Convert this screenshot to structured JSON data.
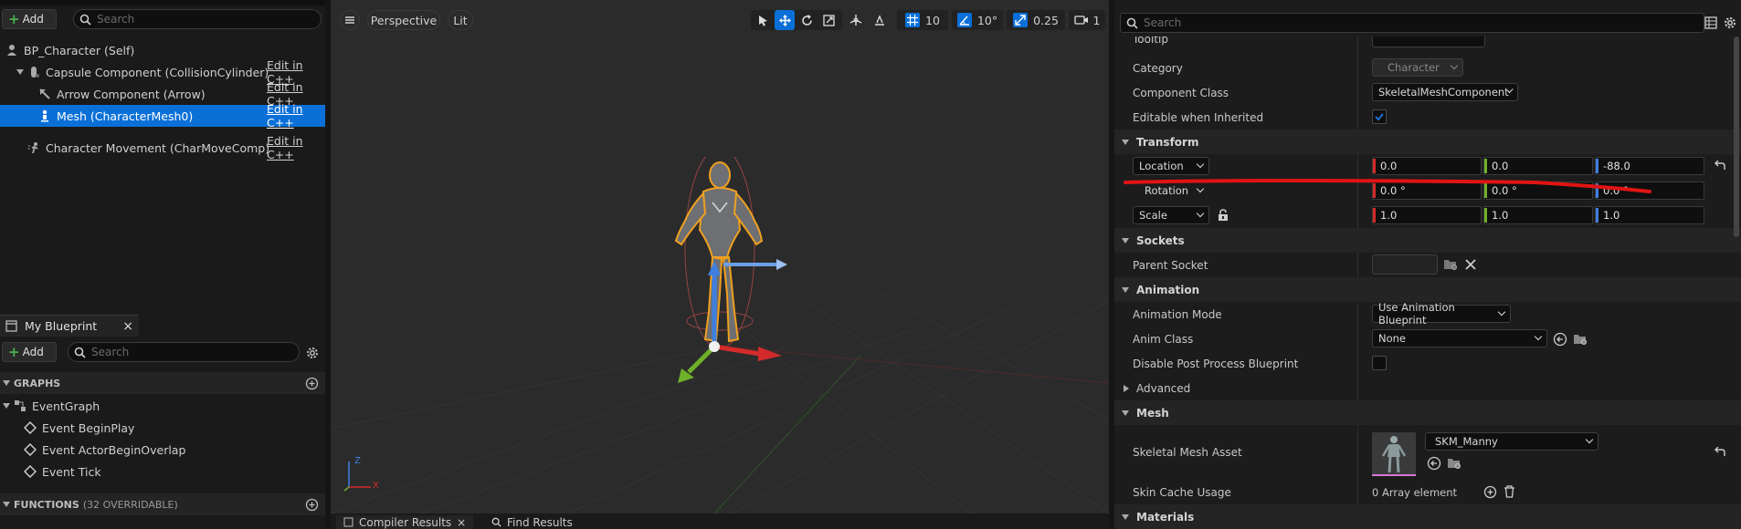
{
  "components": {
    "add_label": "Add",
    "search_placeholder": "Search",
    "items": [
      {
        "label": "BP_Character (Self)",
        "edit": ""
      },
      {
        "label": "Capsule Component (CollisionCylinder)",
        "edit": "Edit in C++"
      },
      {
        "label": "Arrow Component (Arrow)",
        "edit": "Edit in C++"
      },
      {
        "label": "Mesh (CharacterMesh0)",
        "edit": "Edit in C++"
      },
      {
        "label": "Character Movement (CharMoveComp)",
        "edit": "Edit in C++"
      }
    ]
  },
  "my_blueprint": {
    "tab_label": "My Blueprint",
    "close": "×",
    "add_label": "Add",
    "search_placeholder": "Search",
    "graphs_header": "GRAPHS",
    "event_graph": "EventGraph",
    "events": [
      "Event BeginPlay",
      "Event ActorBeginOverlap",
      "Event Tick"
    ],
    "functions_header": "FUNCTIONS",
    "functions_count": "(32 OVERRIDABLE)"
  },
  "viewport": {
    "perspective_label": "Perspective",
    "lit_label": "Lit",
    "grid_snap": "10",
    "rot_snap": "10°",
    "scale_snap": "0.25",
    "camera_speed": "1",
    "axis_x": "X",
    "axis_z": "Z"
  },
  "bottom_tabs": {
    "compiler": "Compiler Results",
    "find": "Find Results"
  },
  "details": {
    "search_placeholder": "Search",
    "tooltip_label": "Tooltip",
    "category_label": "Category",
    "category_value": "Character",
    "component_class_label": "Component Class",
    "component_class_value": "SkeletalMeshComponent",
    "editable_label": "Editable when Inherited",
    "transform_header": "Transform",
    "location_label": "Location",
    "location_values": [
      "0.0",
      "0.0",
      "-88.0"
    ],
    "rotation_label": "Rotation",
    "rotation_values": [
      "0.0 °",
      "0.0 °",
      "0.0 °"
    ],
    "scale_label": "Scale",
    "scale_values": [
      "1.0",
      "1.0",
      "1.0"
    ],
    "sockets_header": "Sockets",
    "parent_socket_label": "Parent Socket",
    "animation_header": "Animation",
    "anim_mode_label": "Animation Mode",
    "anim_mode_value": "Use Animation Blueprint",
    "anim_class_label": "Anim Class",
    "anim_class_value": "None",
    "disable_pp_label": "Disable Post Process Blueprint",
    "advanced_label": "Advanced",
    "mesh_header": "Mesh",
    "skeletal_mesh_label": "Skeletal Mesh Asset",
    "skeletal_mesh_value": "SKM_Manny",
    "skin_cache_label": "Skin Cache Usage",
    "skin_cache_value": "0 Array element",
    "materials_header": "Materials"
  },
  "colors": {
    "selection": "#0a70d8",
    "x_axis": "#d32b2b",
    "y_axis": "#6fb12a",
    "z_axis": "#3f7fe0",
    "annotation": "#e01414",
    "check": "#1f6fd1"
  }
}
